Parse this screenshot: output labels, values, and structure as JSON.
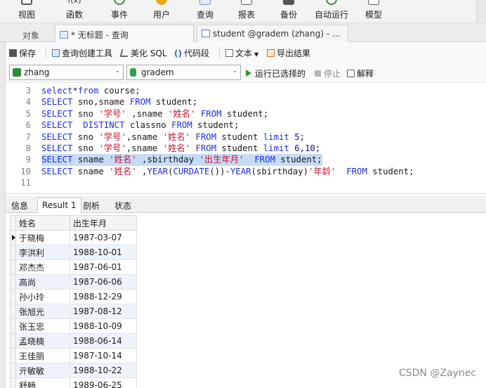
{
  "main_toolbar": {
    "items": [
      {
        "label": "视图",
        "icon": "view-icon"
      },
      {
        "label": "函数",
        "icon": "function-icon"
      },
      {
        "label": "事件",
        "icon": "event-icon"
      },
      {
        "label": "用户",
        "icon": "user-icon"
      },
      {
        "label": "查询",
        "icon": "query-icon"
      },
      {
        "label": "报表",
        "icon": "report-icon"
      },
      {
        "label": "备份",
        "icon": "backup-icon"
      },
      {
        "label": "自动运行",
        "icon": "autorun-icon"
      },
      {
        "label": "模型",
        "icon": "model-icon"
      }
    ],
    "top_glyph": "f(x)"
  },
  "tabs": [
    {
      "label": "对象"
    },
    {
      "label": "* 无标题 - 查询"
    },
    {
      "label": "student @gradem (zhang) - ..."
    }
  ],
  "query_toolbar": {
    "save": "保存",
    "builder": "查询创建工具",
    "beautify": "美化 SQL",
    "snippet": "代码段",
    "text": "文本",
    "export": "导出结果"
  },
  "selectors": {
    "connection": "zhang",
    "database": "gradem",
    "run_selected": "运行已选择的",
    "stop": "停止",
    "explain": "解释"
  },
  "editor": {
    "lines": [
      {
        "n": "3",
        "tokens": [
          [
            "kw",
            "select"
          ],
          [
            "plain",
            "*"
          ],
          [
            "kw",
            "from"
          ],
          [
            "plain",
            " course;"
          ]
        ]
      },
      {
        "n": "4",
        "tokens": [
          [
            "kw",
            "SELECT"
          ],
          [
            "plain",
            " sno,sname "
          ],
          [
            "kw",
            "FROM"
          ],
          [
            "plain",
            " student;"
          ]
        ]
      },
      {
        "n": "5",
        "tokens": [
          [
            "kw",
            "SELECT"
          ],
          [
            "plain",
            " sno "
          ],
          [
            "str",
            "'学号'"
          ],
          [
            "plain",
            " ,sname "
          ],
          [
            "str",
            "'姓名'"
          ],
          [
            "plain",
            " "
          ],
          [
            "kw",
            "FROM"
          ],
          [
            "plain",
            " student;"
          ]
        ]
      },
      {
        "n": "6",
        "tokens": [
          [
            "kw",
            "SELECT"
          ],
          [
            "plain",
            "  "
          ],
          [
            "kw",
            "DISTINCT"
          ],
          [
            "plain",
            " classno "
          ],
          [
            "kw",
            "FROM"
          ],
          [
            "plain",
            " student;"
          ]
        ]
      },
      {
        "n": "7",
        "tokens": [
          [
            "kw",
            "SELECT"
          ],
          [
            "plain",
            " sno "
          ],
          [
            "str",
            "'学号'"
          ],
          [
            "plain",
            ",sname "
          ],
          [
            "str",
            "'姓名'"
          ],
          [
            "plain",
            " "
          ],
          [
            "kw",
            "FROM"
          ],
          [
            "plain",
            " student "
          ],
          [
            "kw",
            "limit"
          ],
          [
            "plain",
            " "
          ],
          [
            "num",
            "5"
          ],
          [
            "plain",
            ";"
          ]
        ]
      },
      {
        "n": "8",
        "tokens": [
          [
            "kw",
            "SELECT"
          ],
          [
            "plain",
            " sno "
          ],
          [
            "str",
            "'学号'"
          ],
          [
            "plain",
            ",sname "
          ],
          [
            "str",
            "'姓名'"
          ],
          [
            "plain",
            " "
          ],
          [
            "kw",
            "FROM"
          ],
          [
            "plain",
            " student "
          ],
          [
            "kw",
            "limit"
          ],
          [
            "plain",
            " "
          ],
          [
            "num",
            "6"
          ],
          [
            "plain",
            ","
          ],
          [
            "num",
            "10"
          ],
          [
            "plain",
            ";"
          ]
        ]
      },
      {
        "n": "9",
        "selected": true,
        "tokens": [
          [
            "kw",
            "SELECT"
          ],
          [
            "plain",
            " sname "
          ],
          [
            "str",
            "'姓名'"
          ],
          [
            "plain",
            " ,sbirthday "
          ],
          [
            "str",
            "'出生年月'"
          ],
          [
            "plain",
            "  "
          ],
          [
            "kw",
            "FROM"
          ],
          [
            "plain",
            " student;"
          ]
        ]
      },
      {
        "n": "10",
        "tokens": [
          [
            "kw",
            "SELECT"
          ],
          [
            "plain",
            " sname "
          ],
          [
            "str",
            "'姓名'"
          ],
          [
            "plain",
            " ,"
          ],
          [
            "kw",
            "YEAR"
          ],
          [
            "plain",
            "("
          ],
          [
            "kw",
            "CURDATE"
          ],
          [
            "plain",
            "())-"
          ],
          [
            "kw",
            "YEAR"
          ],
          [
            "plain",
            "(sbirthday)"
          ],
          [
            "str",
            "'年龄'"
          ],
          [
            "plain",
            "  "
          ],
          [
            "kw",
            "FROM"
          ],
          [
            "plain",
            " student;"
          ]
        ]
      },
      {
        "n": "11",
        "tokens": []
      }
    ]
  },
  "result_tabs": [
    {
      "label": "信息"
    },
    {
      "label": "Result 1"
    },
    {
      "label": "剖析"
    },
    {
      "label": "状态"
    }
  ],
  "grid": {
    "columns": [
      "姓名",
      "出生年月"
    ],
    "rows": [
      [
        "于晓梅",
        "1987-03-07"
      ],
      [
        "李洪利",
        "1988-10-01"
      ],
      [
        "邓杰杰",
        "1987-06-01"
      ],
      [
        "高尚",
        "1987-06-06"
      ],
      [
        "孙小玲",
        "1988-12-29"
      ],
      [
        "张旭光",
        "1987-08-12"
      ],
      [
        "张玉忠",
        "1988-10-09"
      ],
      [
        "孟晓楠",
        "1988-06-14"
      ],
      [
        "王佳丽",
        "1987-10-14"
      ],
      [
        "亓敏敏",
        "1988-10-22"
      ],
      [
        "舒畅",
        "1989-06-25"
      ]
    ]
  },
  "watermark": "CSDN @Zaynec",
  "colors": {
    "keyword": "#1f2fdd",
    "string": "#c8102e",
    "selection": "#c6dcf6",
    "run": "#2e9a2e"
  }
}
